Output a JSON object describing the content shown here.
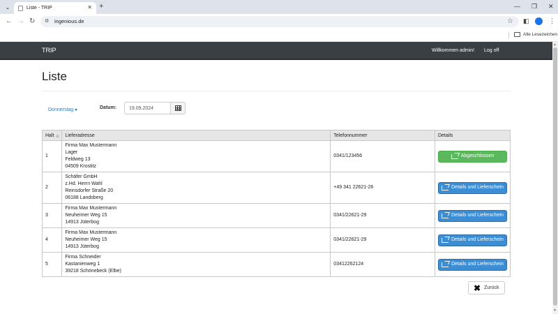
{
  "browser": {
    "tab_title": "Liste - TRIP",
    "url": "ingenious.de",
    "bookmarks_label": "Alle Lesezeichen"
  },
  "navbar": {
    "brand": "TRIP",
    "welcome": "Willkommen admin!",
    "logoff": "Log off"
  },
  "page": {
    "title": "Liste",
    "day_dropdown": "Donnerstag",
    "date_label": "Datum:",
    "date_value": "19.09.2024",
    "back_label": "Zurück"
  },
  "table": {
    "headers": {
      "halt": "Halt",
      "address": "Lieferadresse",
      "phone": "Telefonnummer",
      "details": "Details"
    },
    "rows": [
      {
        "halt": "1",
        "address": [
          "Firma Max Mustermann",
          "Lager",
          "Feldweg 13",
          "04509 Krostitz"
        ],
        "phone": "0341/123456",
        "action": "Abgeschlossen",
        "action_type": "done"
      },
      {
        "halt": "2",
        "address": [
          "Schäfer GmbH",
          "z.Hd. Herrn Wahl",
          "Reinsdorfer Straße 20",
          "06188 Landsberg"
        ],
        "phone": "+49 341 22621-26",
        "action": "Details und Lieferschein",
        "action_type": "details"
      },
      {
        "halt": "3",
        "address": [
          "Firma Max Mustermann",
          "Neuheimer Weg 15",
          "14913 Jüterbog"
        ],
        "phone": "0341/22621-29",
        "action": "Details und Lieferschein",
        "action_type": "details"
      },
      {
        "halt": "4",
        "address": [
          "Firma Max Mustermann",
          "Neuheimer Weg 15",
          "14913 Jüterbog"
        ],
        "phone": "0341/22621-29",
        "action": "Details und Lieferschein",
        "action_type": "details"
      },
      {
        "halt": "5",
        "address": [
          "Firma Schneider",
          "Kastanienweg 1",
          "39218 Schönebeck (Elbe)"
        ],
        "phone": "03412262124",
        "action": "Details und Lieferschein",
        "action_type": "details"
      }
    ]
  },
  "colors": {
    "navbar_bg": "#3a3f44",
    "done_button": "#5cb85c",
    "details_button": "#3c8dd4",
    "link": "#337ab7"
  }
}
